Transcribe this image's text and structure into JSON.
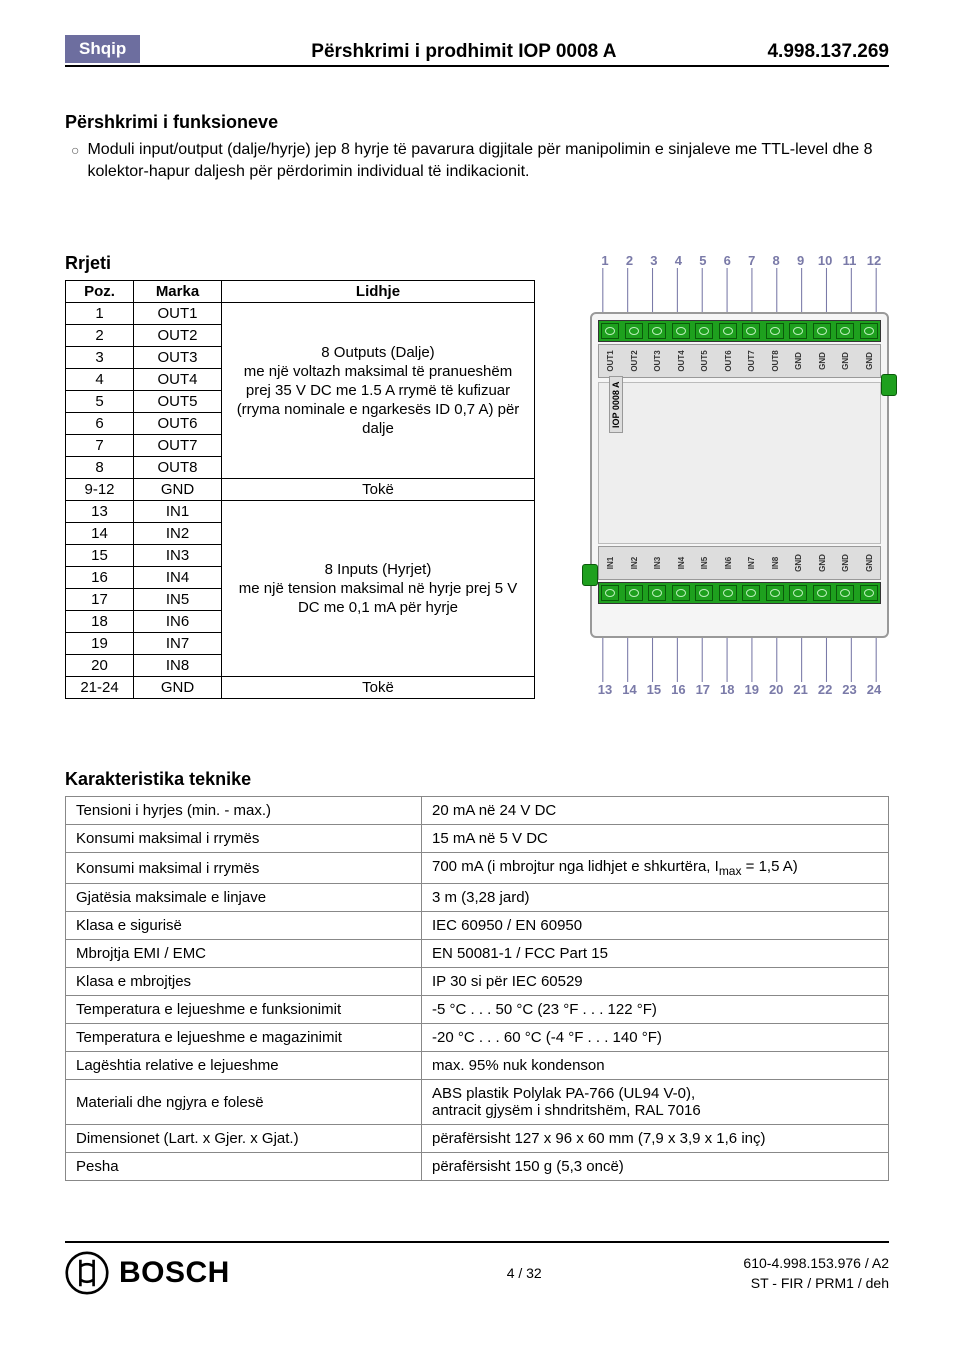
{
  "header": {
    "language": "Shqip",
    "title": "Përshkrimi i prodhimit IOP 0008 A",
    "doc_number": "4.998.137.269"
  },
  "func": {
    "heading": "Përshkrimi i funksioneve",
    "bullet": "Moduli input/output (dalje/hyrje) jep 8 hyrje të pavarura digjitale për manipolimin e sinjaleve me TTL-level dhe 8 kolektor-hapur daljesh për përdorimin individual të indikacionit."
  },
  "network": {
    "heading": "Rrjeti",
    "col_pos": "Poz.",
    "col_brand": "Marka",
    "col_conn": "Lidhje",
    "outputs_desc": "8 Outputs (Dalje)\nme një voltazh maksimal të pranueshëm prej 35 V DC me 1.5 A rrymë të kufizuar (rryma nominale e ngarkesës ID 0,7 A) për dalje",
    "inputs_desc": "8 Inputs (Hyrjet)\nme një tension maksimal në hyrje prej 5 V DC me 0,1 mA për hyrje",
    "ground": "Tokë",
    "rows_out": [
      {
        "pos": "1",
        "brand": "OUT1"
      },
      {
        "pos": "2",
        "brand": "OUT2"
      },
      {
        "pos": "3",
        "brand": "OUT3"
      },
      {
        "pos": "4",
        "brand": "OUT4"
      },
      {
        "pos": "5",
        "brand": "OUT5"
      },
      {
        "pos": "6",
        "brand": "OUT6"
      },
      {
        "pos": "7",
        "brand": "OUT7"
      },
      {
        "pos": "8",
        "brand": "OUT8"
      }
    ],
    "gnd1": {
      "pos": "9-12",
      "brand": "GND"
    },
    "rows_in": [
      {
        "pos": "13",
        "brand": "IN1"
      },
      {
        "pos": "14",
        "brand": "IN2"
      },
      {
        "pos": "15",
        "brand": "IN3"
      },
      {
        "pos": "16",
        "brand": "IN4"
      },
      {
        "pos": "17",
        "brand": "IN5"
      },
      {
        "pos": "18",
        "brand": "IN6"
      },
      {
        "pos": "19",
        "brand": "IN7"
      },
      {
        "pos": "20",
        "brand": "IN8"
      }
    ],
    "gnd2": {
      "pos": "21-24",
      "brand": "GND"
    }
  },
  "diagram": {
    "top_pins": [
      "1",
      "2",
      "3",
      "4",
      "5",
      "6",
      "7",
      "8",
      "9",
      "10",
      "11",
      "12"
    ],
    "bottom_pins": [
      "13",
      "14",
      "15",
      "16",
      "17",
      "18",
      "19",
      "20",
      "21",
      "22",
      "23",
      "24"
    ],
    "top_labels": [
      "OUT1",
      "OUT2",
      "OUT3",
      "OUT4",
      "OUT5",
      "OUT6",
      "OUT7",
      "OUT8",
      "GND",
      "GND",
      "GND",
      "GND"
    ],
    "bottom_labels": [
      "IN1",
      "IN2",
      "IN3",
      "IN4",
      "IN5",
      "IN6",
      "IN7",
      "IN8",
      "GND",
      "GND",
      "GND",
      "GND"
    ],
    "chip": "IOP 0008 A"
  },
  "specs": {
    "heading": "Karakteristika teknike",
    "rows": [
      [
        "Tensioni i hyrjes (min. - max.)",
        "20 mA në 24 V DC"
      ],
      [
        "Konsumi maksimal i rrymës",
        "15 mA në 5 V DC"
      ],
      [
        "Konsumi maksimal i rrymës",
        "700 mA (i mbrojtur nga lidhjet e shkurtëra, I<sub>max</sub> = 1,5 A)"
      ],
      [
        "Gjatësia maksimale e linjave",
        "3 m  (3,28 jard)"
      ],
      [
        "Klasa e sigurisë",
        "IEC 60950 / EN 60950"
      ],
      [
        "Mbrojtja EMI / EMC",
        "EN 50081-1 / FCC Part 15"
      ],
      [
        "Klasa e mbrojtjes",
        "IP 30 si për IEC 60529"
      ],
      [
        "Temperatura e lejueshme e funksionimit",
        "-5 °C . . . 50 °C  (23 °F . . . 122 °F)"
      ],
      [
        "Temperatura e lejueshme e magazinimit",
        "-20 °C . . .  60 °C  (-4 °F . . . 140 °F)"
      ],
      [
        "Lagështia relative e lejueshme",
        "max. 95% nuk kondenson"
      ],
      [
        "Materiali dhe ngjyra e folesë",
        "ABS plastik Polylak PA-766 (UL94 V-0),\nantracit gjysëm i shndritshëm, RAL 7016"
      ],
      [
        "Dimensionet (Lart. x Gjer. x Gjat.)",
        "përafërsisht 127 x 96 x 60 mm  (7,9 x 3,9 x 1,6 inç)"
      ],
      [
        "Pesha",
        "përafërsisht 150 g  (5,3 oncë)"
      ]
    ]
  },
  "footer": {
    "brand": "BOSCH",
    "page": "4 / 32",
    "meta1": "610-4.998.153.976 / A2",
    "meta2": "ST - FIR / PRM1 / deh"
  }
}
